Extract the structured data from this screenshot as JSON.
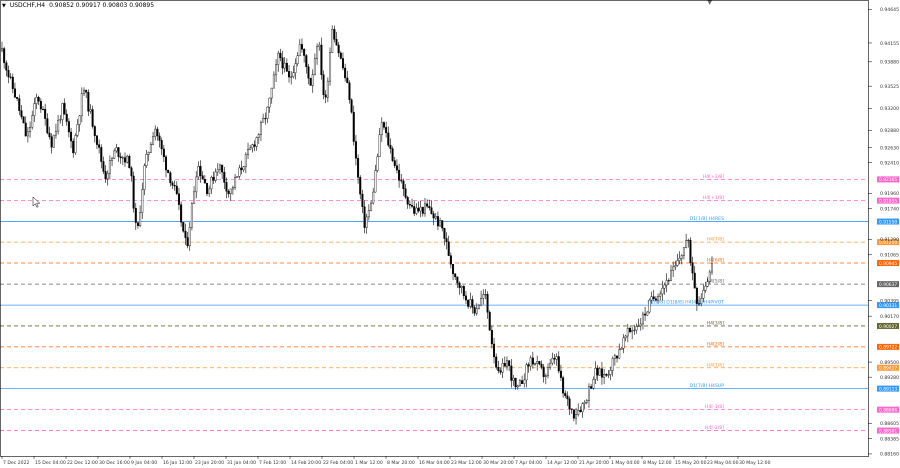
{
  "header": {
    "symbol": "USDCHF,H4",
    "ohlc": "0.90852 0.90917 0.90803 0.90895"
  },
  "chart_data": {
    "type": "candlestick",
    "symbol": "USDCHF",
    "timeframe": "H4",
    "ylim": [
      0.8813,
      0.94665
    ],
    "price_ticks": [
      "0.94645",
      "0.94155",
      "0.93880",
      "0.93525",
      "0.93200",
      "0.92880",
      "0.92630",
      "0.92410",
      "0.91960",
      "0.91740",
      "0.91290",
      "0.91065",
      "0.90395",
      "0.90170",
      "0.89500",
      "0.89280",
      "0.88605",
      "0.88385",
      "0.88160"
    ],
    "time_labels": [
      "7 Dec 2022",
      "15 Dec 04:00",
      "22 Dec 12:00",
      "30 Dec 16:00",
      "9 Jan 04:00",
      "16 Jan 12:00",
      "23 Jan 20:00",
      "31 Jan 04:00",
      "7 Feb 12:00",
      "14 Feb 20:00",
      "22 Feb 04:00",
      "1 Mar 12:00",
      "8 Mar 20:00",
      "16 Mar 04:00",
      "23 Mar 12:00",
      "30 Mar 20:00",
      "7 Apr 04:00",
      "14 Apr 12:00",
      "21 Apr 20:00",
      "1 May 04:00",
      "8 May 12:00",
      "15 May 20:00",
      "23 May 04:00",
      "30 May 12:00"
    ],
    "path_keyframes": [
      [
        0,
        0.9405
      ],
      [
        0.01,
        0.9365
      ],
      [
        0.02,
        0.9335
      ],
      [
        0.035,
        0.9275
      ],
      [
        0.05,
        0.934
      ],
      [
        0.07,
        0.927
      ],
      [
        0.085,
        0.932
      ],
      [
        0.1,
        0.926
      ],
      [
        0.115,
        0.935
      ],
      [
        0.13,
        0.929
      ],
      [
        0.145,
        0.922
      ],
      [
        0.16,
        0.926
      ],
      [
        0.18,
        0.924
      ],
      [
        0.19,
        0.913
      ],
      [
        0.2,
        0.923
      ],
      [
        0.215,
        0.9295
      ],
      [
        0.23,
        0.924
      ],
      [
        0.245,
        0.9195
      ],
      [
        0.26,
        0.9115
      ],
      [
        0.275,
        0.924
      ],
      [
        0.29,
        0.92
      ],
      [
        0.305,
        0.924
      ],
      [
        0.32,
        0.9195
      ],
      [
        0.34,
        0.924
      ],
      [
        0.36,
        0.928
      ],
      [
        0.375,
        0.932
      ],
      [
        0.39,
        0.94
      ],
      [
        0.405,
        0.936
      ],
      [
        0.42,
        0.9415
      ],
      [
        0.435,
        0.9355
      ],
      [
        0.445,
        0.9425
      ],
      [
        0.455,
        0.932
      ],
      [
        0.465,
        0.944
      ],
      [
        0.48,
        0.938
      ],
      [
        0.49,
        0.9335
      ],
      [
        0.5,
        0.923
      ],
      [
        0.51,
        0.915
      ],
      [
        0.52,
        0.918
      ],
      [
        0.535,
        0.93
      ],
      [
        0.55,
        0.925
      ],
      [
        0.565,
        0.92
      ],
      [
        0.58,
        0.917
      ],
      [
        0.6,
        0.9175
      ],
      [
        0.62,
        0.9145
      ],
      [
        0.635,
        0.9085
      ],
      [
        0.65,
        0.905
      ],
      [
        0.665,
        0.9025
      ],
      [
        0.68,
        0.905
      ],
      [
        0.69,
        0.898
      ],
      [
        0.7,
        0.8925
      ],
      [
        0.71,
        0.8955
      ],
      [
        0.725,
        0.8905
      ],
      [
        0.745,
        0.8955
      ],
      [
        0.765,
        0.893
      ],
      [
        0.78,
        0.896
      ],
      [
        0.79,
        0.8905
      ],
      [
        0.805,
        0.8875
      ],
      [
        0.82,
        0.889
      ],
      [
        0.835,
        0.8935
      ],
      [
        0.85,
        0.893
      ],
      [
        0.865,
        0.896
      ],
      [
        0.88,
        0.899
      ],
      [
        0.9,
        0.901
      ],
      [
        0.915,
        0.904
      ],
      [
        0.93,
        0.906
      ],
      [
        0.95,
        0.909
      ],
      [
        0.965,
        0.913
      ],
      [
        0.98,
        0.9035
      ],
      [
        1,
        0.909
      ]
    ],
    "levels": [
      {
        "label": "H4[+2/8]",
        "price_label": "0.92165",
        "price": 0.92165,
        "color": "#ff66cc",
        "style": "dash",
        "badge_text": "#ffffff"
      },
      {
        "label": "H4[+1/8]",
        "price_label": "0.91855",
        "price": 0.91855,
        "color": "#ff66cc",
        "style": "dash",
        "badge_text": "#ffffff"
      },
      {
        "label": "D1[1/8] H4RES",
        "price_label": "0.91550",
        "price": 0.9155,
        "color": "#3399ff",
        "style": "solid",
        "badge_text": "#ffffff"
      },
      {
        "label": "H4[7/8]",
        "price_label": "0.91250",
        "price": 0.9125,
        "color": "#ff9933",
        "style": "dash",
        "badge_text": "#ffffff"
      },
      {
        "label": "H4[6/8]",
        "price_label": "0.90945",
        "price": 0.90945,
        "color": "#ff6600",
        "style": "dash",
        "badge_text": "#ffffff"
      },
      {
        "label": "H4[5/8]",
        "price_label": "0.90637",
        "price": 0.90637,
        "color": "#666666",
        "style": "dash",
        "badge_text": "#ffffff"
      },
      {
        "label": "D1[0/8] D1[8/8] H4[4/8] H4PIVOT",
        "price_label": "0.90331",
        "price": 0.90331,
        "color": "#3399ff",
        "style": "solid",
        "badge_text": "#ffffff"
      },
      {
        "label": "H4[3/8]",
        "price_label": "0.90027",
        "price": 0.90027,
        "color": "#666633",
        "style": "dash",
        "badge_text": "#ffffff"
      },
      {
        "label": "H4[2/8]",
        "price_label": "0.89722",
        "price": 0.89722,
        "color": "#ff6600",
        "style": "dash",
        "badge_text": "#ffffff"
      },
      {
        "label": "H4[1/8]",
        "price_label": "0.89417",
        "price": 0.89417,
        "color": "#ff9933",
        "style": "dash",
        "badge_text": "#ffffff"
      },
      {
        "label": "D1[7/8] H4SUP",
        "price_label": "0.89113",
        "price": 0.89113,
        "color": "#3399ff",
        "style": "solid",
        "badge_text": "#ffffff"
      },
      {
        "label": "H4[-1/8]",
        "price_label": "0.88806",
        "price": 0.88806,
        "color": "#ff66cc",
        "style": "dash",
        "badge_text": "#ffffff"
      },
      {
        "label": "H4[-2/8]",
        "price_label": "0.88501",
        "price": 0.88501,
        "color": "#ff66cc",
        "style": "dash",
        "badge_text": "#ffffff"
      }
    ],
    "colors": {
      "candles": "#000000",
      "axis": "#000000",
      "labels": "#333333",
      "background": "#ffffff"
    }
  }
}
